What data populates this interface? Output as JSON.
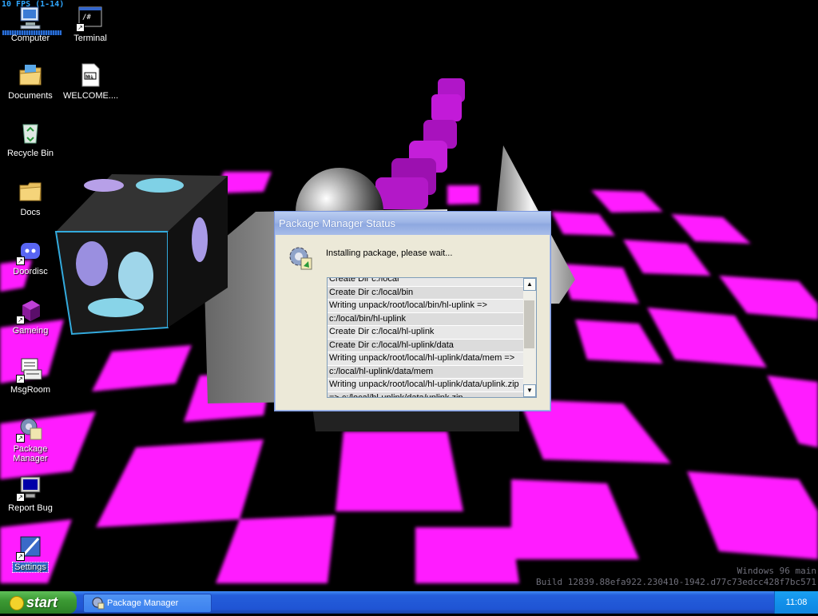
{
  "overlay": {
    "fps": "10 FPS (1-14)",
    "watermark_line1": "Windows 96 main",
    "watermark_line2": "Build 12839.88efa922.230410-1942.d77c73edcc428f7bc571"
  },
  "desktop": {
    "icons": [
      {
        "label": "Computer",
        "icon": "computer-icon"
      },
      {
        "label": "Terminal",
        "icon": "terminal-icon"
      },
      {
        "label": "Documents",
        "icon": "documents-icon"
      },
      {
        "label": "WELCOME....",
        "icon": "markdown-file-icon"
      },
      {
        "label": "Recycle Bin",
        "icon": "recycle-bin-icon"
      },
      {
        "label": "Docs",
        "icon": "folder-icon"
      },
      {
        "label": "Doordisc",
        "icon": "doordisc-icon"
      },
      {
        "label": "Gameing",
        "icon": "gameing-icon"
      },
      {
        "label": "MsgRoom",
        "icon": "msgroom-icon"
      },
      {
        "label": "Package Manager",
        "icon": "package-manager-icon"
      },
      {
        "label": "Report Bug",
        "icon": "report-bug-icon"
      },
      {
        "label": "Settings",
        "icon": "settings-icon"
      }
    ]
  },
  "dialog": {
    "title": "Package Manager Status",
    "message": "Installing package, please wait...",
    "log": [
      "Create Dir c:/local",
      "Create Dir c:/local/bin",
      "Writing unpack/root/local/bin/hl-uplink =>",
      "c:/local/bin/hl-uplink",
      "Create Dir c:/local/hl-uplink",
      "Create Dir c:/local/hl-uplink/data",
      "Writing unpack/root/local/hl-uplink/data/mem =>",
      "c:/local/hl-uplink/data/mem",
      "Writing unpack/root/local/hl-uplink/data/uplink.zip",
      "=> c:/local/hl-uplink/data/uplink.zip"
    ]
  },
  "taskbar": {
    "start_label": "start",
    "task_label": "Package Manager",
    "clock": "11:08"
  },
  "colors": {
    "checker_magenta": "#ff1aff",
    "taskbar_blue": "#245edb",
    "start_green": "#3c9a34"
  }
}
